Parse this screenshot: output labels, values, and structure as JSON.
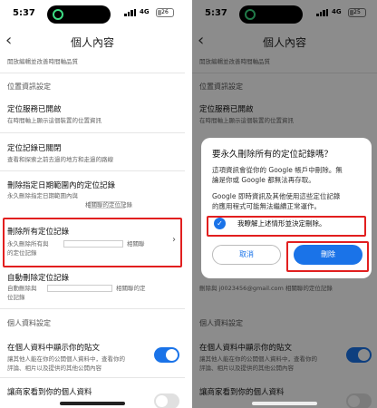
{
  "status_left": {
    "time": "5:37",
    "network": "4G",
    "battery": "26",
    "battery_level": 0.26
  },
  "status_right": {
    "time": "5:37",
    "network": "4G",
    "battery": "25",
    "battery_level": 0.25
  },
  "header": {
    "back_icon": "chevron-left-icon",
    "title": "個人內容"
  },
  "left": {
    "top_cut_text": "開放編輯並改善時間軸品質",
    "location_settings_label": "位置資訊設定",
    "location_services": {
      "title": "定位服務已開啟",
      "desc": "在時間軸上顯示這個裝置的位置資訊"
    },
    "location_history": {
      "title": "定位記錄已關閉",
      "desc": "查看和探索之前去過的地方和走過的路線"
    },
    "delete_range": {
      "title": "刪除指定日期範圍內的定位記錄",
      "desc1": "永久刪除指定日期範圍內與",
      "desc2": "相關聯的定位記錄"
    },
    "delete_all": {
      "title": "刪除所有定位記錄",
      "desc1": "永久刪除所有與",
      "desc2": "相關聯",
      "desc3": "的定位記錄"
    },
    "auto_delete": {
      "title": "自動刪除定位記錄",
      "desc1": "自動刪除與",
      "desc2": "相關聯的定",
      "desc3": "位記錄"
    },
    "profile_settings_label": "個人資料設定",
    "show_posts": {
      "title": "在個人資料中顯示你的貼文",
      "desc1": "讓其他人能在你的公開個人資料中，查看你的",
      "desc2": "評論、相片以及提供的其他公開內容",
      "toggle": "on"
    },
    "let_merchants": {
      "title": "讓商家看到你的個人資料",
      "toggle": "off"
    }
  },
  "right": {
    "top_cut_text": "開放編輯並改善時間軸品質",
    "location_settings_label": "位置資訊設定",
    "location_services": {
      "title": "定位服務已開啟",
      "desc": "在時間軸上顯示這個裝置的位置資訊"
    },
    "auto_delete_desc_tail": "刪除與 j0023456@gmail.com 相關聯的定位記錄",
    "profile_settings_label": "個人資料設定",
    "show_posts": {
      "title": "在個人資料中顯示你的貼文",
      "desc1": "讓其他人能在你的公開個人資料中，查看你的",
      "desc2": "評論、相片以及提供的其他公開內容",
      "toggle": "on"
    },
    "let_merchants": {
      "title": "讓商家看到你的個人資料",
      "toggle": "off"
    }
  },
  "dialog": {
    "title": "要永久刪除所有的定位記錄嗎？",
    "body1_line1": "這項資訊會從你的 Google 帳戶中刪除。無",
    "body1_line2": "論是你或 Google 都無法再存取。",
    "body2_line1": "Google 即時資訊及其他使用這些定位記錄",
    "body2_line2": "的應用程式可能無法繼續正常運作。",
    "checkbox_label": "我瞭解上述情形並決定刪除。",
    "cancel_label": "取消",
    "delete_label": "刪除"
  },
  "colors": {
    "accent": "#1a73e8",
    "highlight": "#e21f1f"
  }
}
